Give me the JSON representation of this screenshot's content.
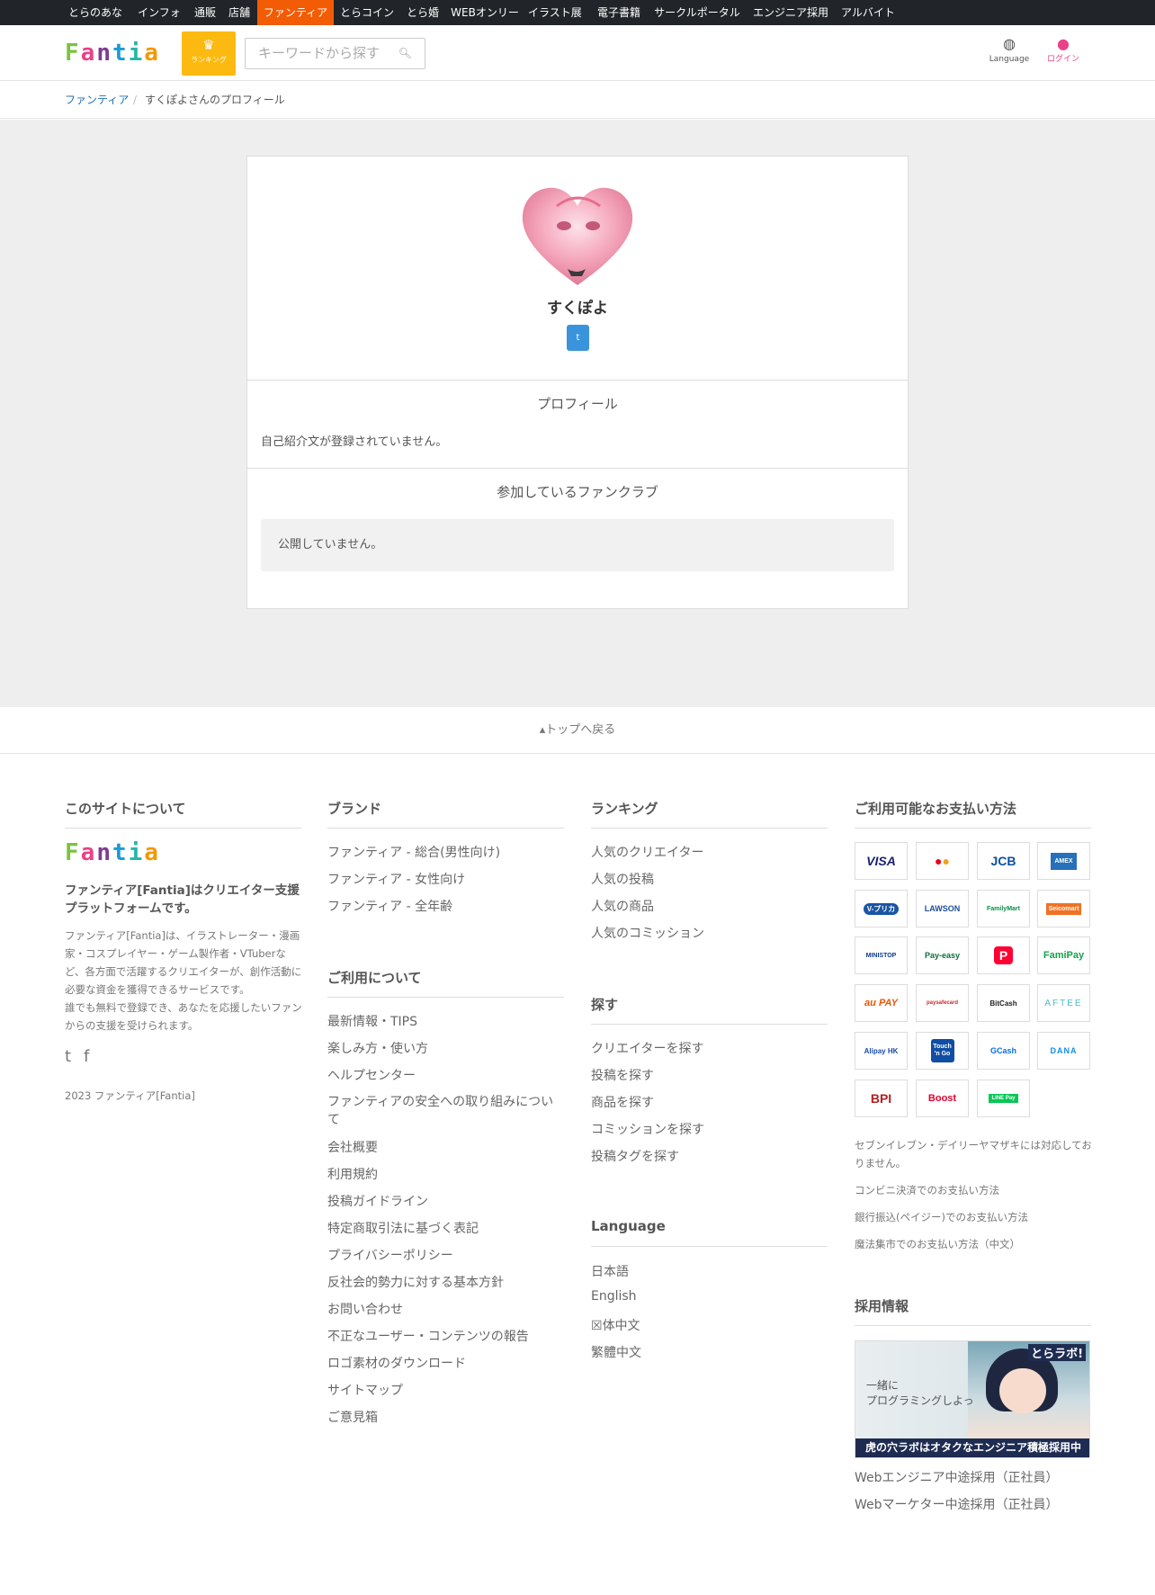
{
  "netbar": {
    "items": [
      "とらのあな",
      "インフォ",
      "通販",
      "店舗",
      "ファンティア",
      "とらコイン",
      "とら婚",
      "WEBオンリー",
      "イラスト展",
      "電子書籍",
      "サークルポータル",
      "エンジニア採用",
      "アルバイト"
    ],
    "active": "ファンティア"
  },
  "header": {
    "logo": [
      "F",
      "a",
      "n",
      "t",
      "i",
      "a"
    ],
    "ranking_icon": "crown-icon",
    "ranking_label": "ランキング",
    "search_placeholder": "キーワードから探す",
    "search_icon": "search-icon",
    "language_label": "Language",
    "login_label": "ログイン"
  },
  "breadcrumb": {
    "home": "ファンティア",
    "separator": "/",
    "current": "すくぽよさんのプロフィール"
  },
  "profile": {
    "name": "すくぽよ",
    "twitter_icon": "twitter-icon",
    "profile_title": "プロフィール",
    "profile_text": "自己紹介文が登録されていません。",
    "fanclub_title": "参加しているファンクラブ",
    "fanclub_text": "公開していません。"
  },
  "back_to_top": "トップへ戻る",
  "footer": {
    "about": {
      "title": "このサイトについて",
      "tagline": "ファンティア[Fantia]はクリエイター支援プラットフォームです。",
      "desc1": "ファンティア[Fantia]は、イラストレーター・漫画家・コスプレイヤー・ゲーム製作者・VTuberなど、各方面で活躍するクリエイターが、創作活動に必要な資金を獲得できるサービスです。",
      "desc2": "誰でも無料で登録でき、あなたを応援したいファンからの支援を受けられます。",
      "copyright": "2023 ファンティア[Fantia]"
    },
    "brand": {
      "title": "ブランド",
      "items": [
        "ファンティア - 総合(男性向け)",
        "ファンティア - 女性向け",
        "ファンティア - 全年齢"
      ]
    },
    "usage": {
      "title": "ご利用について",
      "items": [
        "最新情報・TIPS",
        "楽しみ方・使い方",
        "ヘルプセンター",
        "ファンティアの安全への取り組みについて",
        "会社概要",
        "利用規約",
        "投稿ガイドライン",
        "特定商取引法に基づく表記",
        "プライバシーポリシー",
        "反社会的勢力に対する基本方針",
        "お問い合わせ",
        "不正なユーザー・コンテンツの報告",
        "ロゴ素材のダウンロード",
        "サイトマップ",
        "ご意見箱"
      ]
    },
    "ranking": {
      "title": "ランキング",
      "items": [
        "人気のクリエイター",
        "人気の投稿",
        "人気の商品",
        "人気のコミッション"
      ]
    },
    "search": {
      "title": "探す",
      "items": [
        "クリエイターを探す",
        "投稿を探す",
        "商品を探す",
        "コミッションを探す",
        "投稿タグを探す"
      ]
    },
    "language": {
      "title": "Language",
      "items": [
        "日本語",
        "English",
        "体中文",
        "繁體中文"
      ]
    },
    "payment": {
      "title": "ご利用可能なお支払い方法",
      "methods": [
        "VISA",
        "mastercard",
        "JCB",
        "AMEX",
        "V-プリカ",
        "LAWSON",
        "FamilyMart",
        "Seicomart",
        "MINISTOP",
        "Pay-easy",
        "PayPay",
        "FamiPay",
        "au PAY",
        "paysafecard",
        "BitCash",
        "AFTEE",
        "Alipay HK",
        "Touch 'n Go",
        "GCash",
        "DANA",
        "BPI",
        "Boost",
        "LINE Pay"
      ],
      "note": "セブンイレブン・デイリーヤマザキには対応しておりません。",
      "links": [
        "コンビニ決済でのお支払い方法",
        "銀行振込(ペイジー)でのお支払い方法",
        "魔法集市でのお支払い方法（中文）"
      ]
    },
    "recruit": {
      "title": "採用情報",
      "banner_brand": "とらラボ!",
      "banner_copy1": "一緒に",
      "banner_copy2": "プログラミングしよっ",
      "banner_caption": "虎の穴ラボはオタクなエンジニア積極採用中",
      "items": [
        "Webエンジニア中途採用（正社員）",
        "Webマーケター中途採用（正社員）"
      ]
    }
  }
}
